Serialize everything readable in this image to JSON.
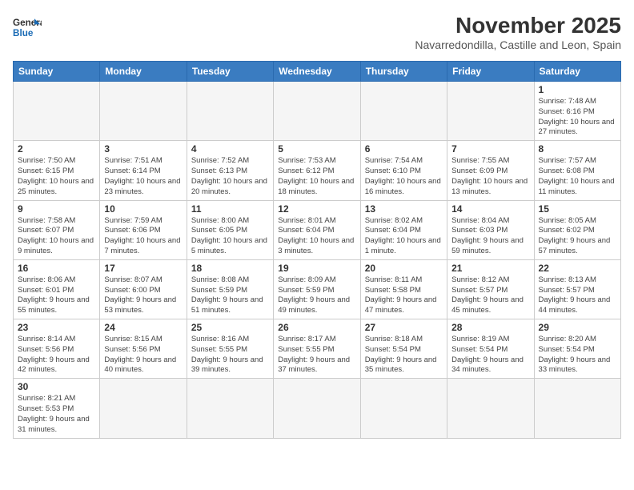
{
  "logo": {
    "line1": "General",
    "line2": "Blue"
  },
  "title": "November 2025",
  "location": "Navarredondilla, Castille and Leon, Spain",
  "weekdays": [
    "Sunday",
    "Monday",
    "Tuesday",
    "Wednesday",
    "Thursday",
    "Friday",
    "Saturday"
  ],
  "weeks": [
    [
      {
        "day": "",
        "info": ""
      },
      {
        "day": "",
        "info": ""
      },
      {
        "day": "",
        "info": ""
      },
      {
        "day": "",
        "info": ""
      },
      {
        "day": "",
        "info": ""
      },
      {
        "day": "",
        "info": ""
      },
      {
        "day": "1",
        "info": "Sunrise: 7:48 AM\nSunset: 6:16 PM\nDaylight: 10 hours\nand 27 minutes."
      }
    ],
    [
      {
        "day": "2",
        "info": "Sunrise: 7:50 AM\nSunset: 6:15 PM\nDaylight: 10 hours\nand 25 minutes."
      },
      {
        "day": "3",
        "info": "Sunrise: 7:51 AM\nSunset: 6:14 PM\nDaylight: 10 hours\nand 23 minutes."
      },
      {
        "day": "4",
        "info": "Sunrise: 7:52 AM\nSunset: 6:13 PM\nDaylight: 10 hours\nand 20 minutes."
      },
      {
        "day": "5",
        "info": "Sunrise: 7:53 AM\nSunset: 6:12 PM\nDaylight: 10 hours\nand 18 minutes."
      },
      {
        "day": "6",
        "info": "Sunrise: 7:54 AM\nSunset: 6:10 PM\nDaylight: 10 hours\nand 16 minutes."
      },
      {
        "day": "7",
        "info": "Sunrise: 7:55 AM\nSunset: 6:09 PM\nDaylight: 10 hours\nand 13 minutes."
      },
      {
        "day": "8",
        "info": "Sunrise: 7:57 AM\nSunset: 6:08 PM\nDaylight: 10 hours\nand 11 minutes."
      }
    ],
    [
      {
        "day": "9",
        "info": "Sunrise: 7:58 AM\nSunset: 6:07 PM\nDaylight: 10 hours\nand 9 minutes."
      },
      {
        "day": "10",
        "info": "Sunrise: 7:59 AM\nSunset: 6:06 PM\nDaylight: 10 hours\nand 7 minutes."
      },
      {
        "day": "11",
        "info": "Sunrise: 8:00 AM\nSunset: 6:05 PM\nDaylight: 10 hours\nand 5 minutes."
      },
      {
        "day": "12",
        "info": "Sunrise: 8:01 AM\nSunset: 6:04 PM\nDaylight: 10 hours\nand 3 minutes."
      },
      {
        "day": "13",
        "info": "Sunrise: 8:02 AM\nSunset: 6:04 PM\nDaylight: 10 hours\nand 1 minute."
      },
      {
        "day": "14",
        "info": "Sunrise: 8:04 AM\nSunset: 6:03 PM\nDaylight: 9 hours\nand 59 minutes."
      },
      {
        "day": "15",
        "info": "Sunrise: 8:05 AM\nSunset: 6:02 PM\nDaylight: 9 hours\nand 57 minutes."
      }
    ],
    [
      {
        "day": "16",
        "info": "Sunrise: 8:06 AM\nSunset: 6:01 PM\nDaylight: 9 hours\nand 55 minutes."
      },
      {
        "day": "17",
        "info": "Sunrise: 8:07 AM\nSunset: 6:00 PM\nDaylight: 9 hours\nand 53 minutes."
      },
      {
        "day": "18",
        "info": "Sunrise: 8:08 AM\nSunset: 5:59 PM\nDaylight: 9 hours\nand 51 minutes."
      },
      {
        "day": "19",
        "info": "Sunrise: 8:09 AM\nSunset: 5:59 PM\nDaylight: 9 hours\nand 49 minutes."
      },
      {
        "day": "20",
        "info": "Sunrise: 8:11 AM\nSunset: 5:58 PM\nDaylight: 9 hours\nand 47 minutes."
      },
      {
        "day": "21",
        "info": "Sunrise: 8:12 AM\nSunset: 5:57 PM\nDaylight: 9 hours\nand 45 minutes."
      },
      {
        "day": "22",
        "info": "Sunrise: 8:13 AM\nSunset: 5:57 PM\nDaylight: 9 hours\nand 44 minutes."
      }
    ],
    [
      {
        "day": "23",
        "info": "Sunrise: 8:14 AM\nSunset: 5:56 PM\nDaylight: 9 hours\nand 42 minutes."
      },
      {
        "day": "24",
        "info": "Sunrise: 8:15 AM\nSunset: 5:56 PM\nDaylight: 9 hours\nand 40 minutes."
      },
      {
        "day": "25",
        "info": "Sunrise: 8:16 AM\nSunset: 5:55 PM\nDaylight: 9 hours\nand 39 minutes."
      },
      {
        "day": "26",
        "info": "Sunrise: 8:17 AM\nSunset: 5:55 PM\nDaylight: 9 hours\nand 37 minutes."
      },
      {
        "day": "27",
        "info": "Sunrise: 8:18 AM\nSunset: 5:54 PM\nDaylight: 9 hours\nand 35 minutes."
      },
      {
        "day": "28",
        "info": "Sunrise: 8:19 AM\nSunset: 5:54 PM\nDaylight: 9 hours\nand 34 minutes."
      },
      {
        "day": "29",
        "info": "Sunrise: 8:20 AM\nSunset: 5:54 PM\nDaylight: 9 hours\nand 33 minutes."
      }
    ],
    [
      {
        "day": "30",
        "info": "Sunrise: 8:21 AM\nSunset: 5:53 PM\nDaylight: 9 hours\nand 31 minutes."
      },
      {
        "day": "",
        "info": ""
      },
      {
        "day": "",
        "info": ""
      },
      {
        "day": "",
        "info": ""
      },
      {
        "day": "",
        "info": ""
      },
      {
        "day": "",
        "info": ""
      },
      {
        "day": "",
        "info": ""
      }
    ]
  ]
}
